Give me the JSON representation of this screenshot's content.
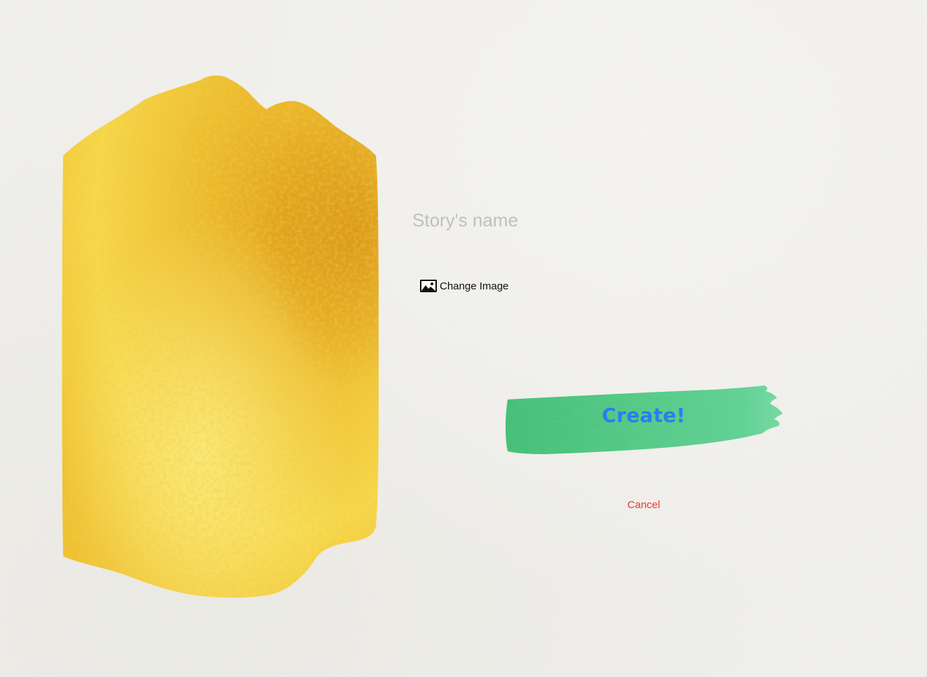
{
  "form": {
    "name_placeholder": "Story's name",
    "name_value": "",
    "change_image_label": "Change Image",
    "create_label": "Create!",
    "cancel_label": "Cancel"
  },
  "icons": {
    "change_image": "photo-icon"
  },
  "colors": {
    "background": "#f1f0ec",
    "cover_yellow": "#f2c838",
    "create_brush_green": "#4fca82",
    "create_text_blue": "#2b7df2",
    "cancel_red": "#e8392b",
    "placeholder_gray": "#bfbfbf"
  }
}
